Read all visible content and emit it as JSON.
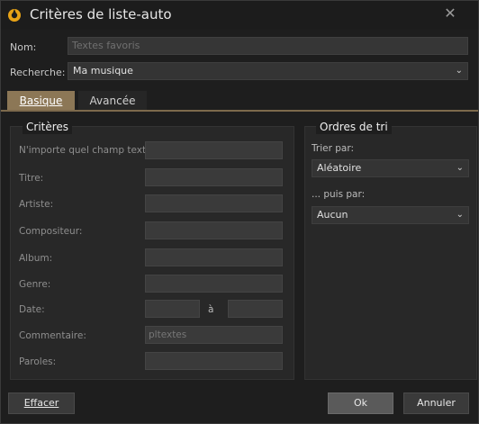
{
  "window": {
    "title": "Critères de liste-auto",
    "close_glyph": "✕"
  },
  "header": {
    "name_label": "Nom:",
    "name_placeholder": "Textes favoris",
    "search_label": "Recherche:",
    "search_value": "Ma musique"
  },
  "tabs": [
    {
      "label": "Basique",
      "active": true
    },
    {
      "label": "Avancée",
      "active": false
    }
  ],
  "criteria": {
    "title": "Critères",
    "fields": [
      {
        "label": "N'importe quel champ texte:",
        "value": ""
      },
      {
        "label": "Titre:",
        "value": ""
      },
      {
        "label": "Artiste:",
        "value": ""
      },
      {
        "label": "Compositeur:",
        "value": ""
      },
      {
        "label": "Album:",
        "value": ""
      },
      {
        "label": "Genre:",
        "value": ""
      },
      {
        "label": "Date:",
        "value": ""
      },
      {
        "label": "Commentaire:",
        "value": "pltextes"
      },
      {
        "label": "Paroles:",
        "value": ""
      }
    ],
    "date_to_label": "à"
  },
  "sort": {
    "title": "Ordres de tri",
    "sort_by_label": "Trier par:",
    "sort_by_value": "Aléatoire",
    "then_by_label": "... puis par:",
    "then_by_value": "Aucun"
  },
  "buttons": {
    "clear": "Effacer",
    "ok": "Ok",
    "cancel": "Annuler"
  },
  "icons": {
    "app": "app-logo-icon",
    "close": "close-icon",
    "chevron": "chevron-down-icon"
  }
}
